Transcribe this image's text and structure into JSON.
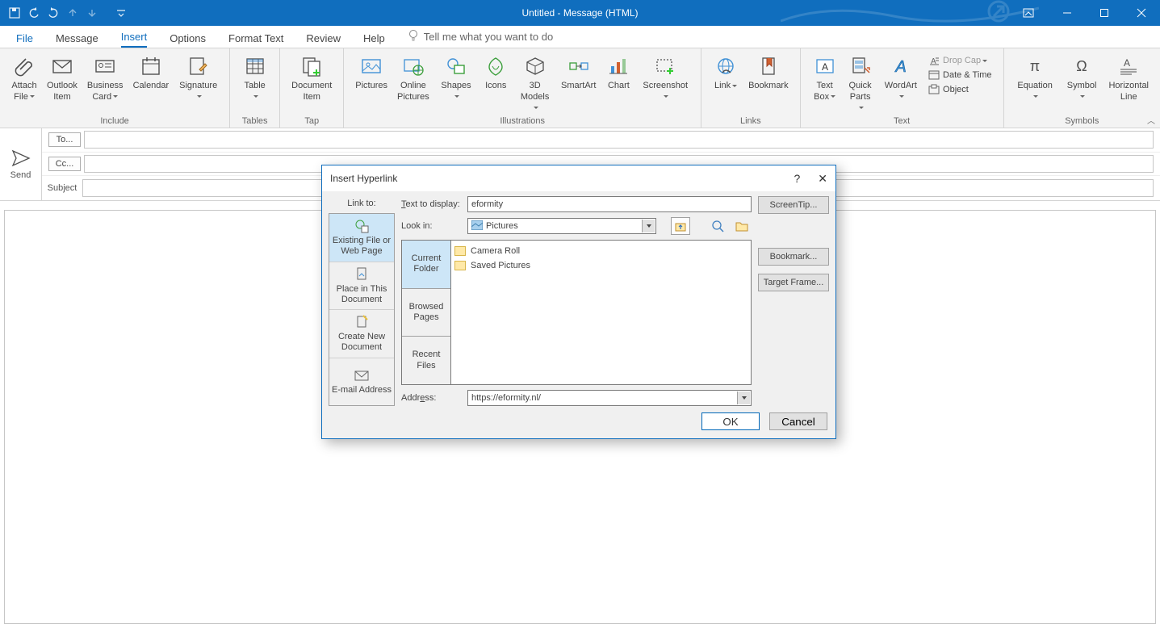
{
  "titlebar": {
    "title": "Untitled  -  Message (HTML)"
  },
  "menu": {
    "file": "File",
    "message": "Message",
    "insert": "Insert",
    "options": "Options",
    "format": "Format Text",
    "review": "Review",
    "help": "Help",
    "tellme": "Tell me what you want to do"
  },
  "ribbon": {
    "include": {
      "label": "Include",
      "attach": "Attach\nFile",
      "outlook": "Outlook\nItem",
      "bizcard": "Business\nCard",
      "calendar": "Calendar",
      "signature": "Signature"
    },
    "tables": {
      "label": "Tables",
      "table": "Table"
    },
    "tap": {
      "label": "Tap",
      "docitem": "Document\nItem"
    },
    "illus": {
      "label": "Illustrations",
      "pictures": "Pictures",
      "onlinepics": "Online\nPictures",
      "shapes": "Shapes",
      "icons": "Icons",
      "models": "3D\nModels",
      "smartart": "SmartArt",
      "chart": "Chart",
      "screenshot": "Screenshot"
    },
    "links": {
      "label": "Links",
      "link": "Link",
      "bookmark": "Bookmark"
    },
    "text": {
      "label": "Text",
      "textbox": "Text\nBox",
      "quickparts": "Quick\nParts",
      "wordart": "WordArt",
      "dropcap": "Drop Cap",
      "datetime": "Date & Time",
      "object": "Object"
    },
    "symbols": {
      "label": "Symbols",
      "equation": "Equation",
      "symbol": "Symbol",
      "hline": "Horizontal\nLine"
    }
  },
  "compose": {
    "send": "Send",
    "to": "To...",
    "cc": "Cc...",
    "subject": "Subject"
  },
  "dialog": {
    "title": "Insert Hyperlink",
    "linkto_label": "Link to:",
    "linkto": {
      "existing": "Existing File or Web Page",
      "place": "Place in This Document",
      "create": "Create New Document",
      "email": "E-mail Address"
    },
    "text_display_label": "Text to display:",
    "text_display_value": "eformity",
    "lookin_label": "Look in:",
    "lookin_value": "Pictures",
    "navtabs": {
      "current": "Current Folder",
      "browsed": "Browsed Pages",
      "recent": "Recent Files"
    },
    "files": {
      "f1": "Camera Roll",
      "f2": "Saved Pictures"
    },
    "address_label": "Address:",
    "address_value": "https://eformity.nl/",
    "buttons": {
      "screentip": "ScreenTip...",
      "bookmark": "Bookmark...",
      "target": "Target Frame...",
      "ok": "OK",
      "cancel": "Cancel"
    }
  }
}
